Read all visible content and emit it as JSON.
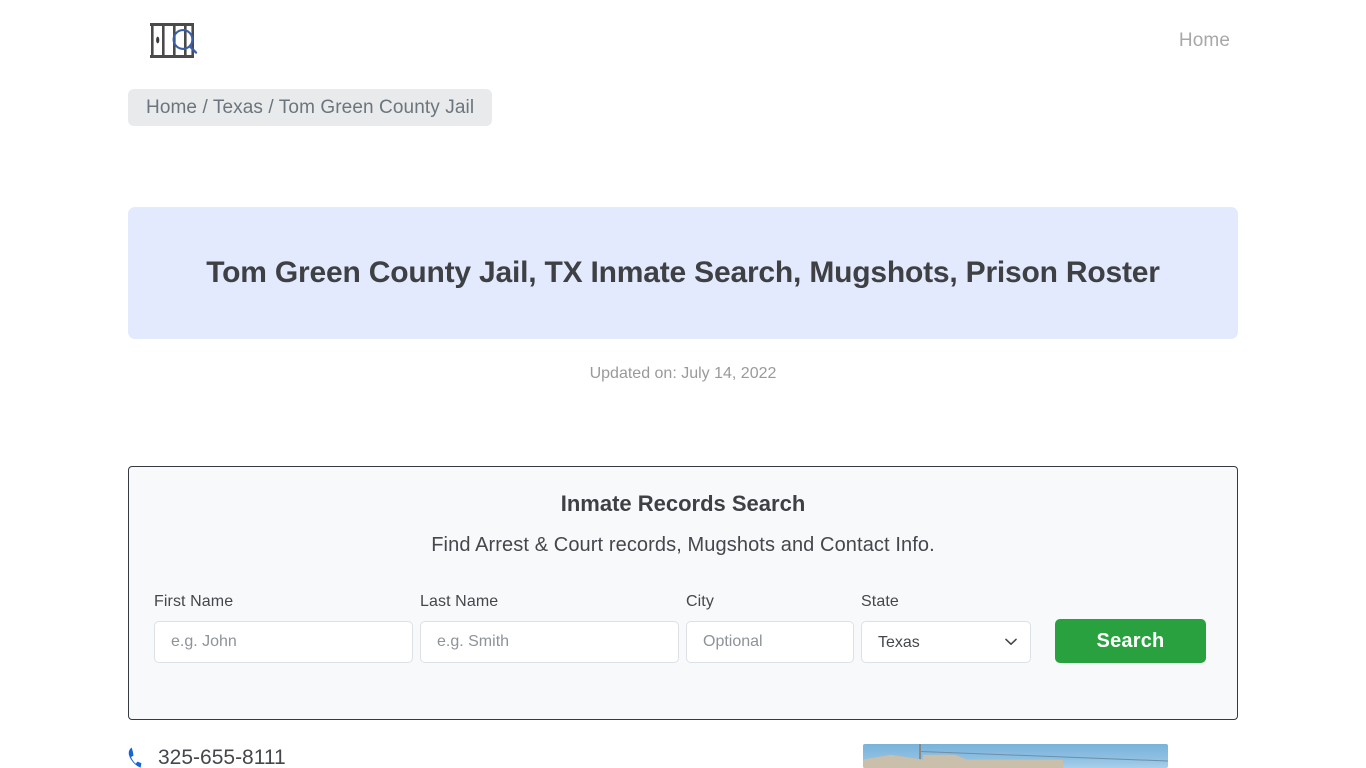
{
  "header": {
    "logo_name": "jail-bars-magnifier-logo",
    "logo_bar_color": "#4a4a4a",
    "logo_glass_color": "#3b5ea8",
    "nav": [
      {
        "label": "Home",
        "name": "nav-link-home"
      }
    ]
  },
  "breadcrumb": {
    "text": "Home / Texas / Tom Green County Jail",
    "items": [
      "Home",
      "Texas",
      "Tom Green County Jail"
    ],
    "separator": "/",
    "background": "#e9eaeb"
  },
  "banner": {
    "title": "Tom Green County Jail, TX Inmate Search, Mugshots, Prison Roster",
    "background": "#e3eafd",
    "text_color": "#3e4044"
  },
  "meta": {
    "updated_label": "Updated on: July 14, 2022"
  },
  "search": {
    "title": "Inmate Records Search",
    "subtitle": "Find Arrest & Court records, Mugshots and Contact Info.",
    "fields": {
      "first_name": {
        "label": "First Name",
        "placeholder": "e.g. John",
        "value": ""
      },
      "last_name": {
        "label": "Last Name",
        "placeholder": "e.g. Smith",
        "value": ""
      },
      "city": {
        "label": "City",
        "placeholder": "Optional",
        "value": ""
      },
      "state": {
        "label": "State",
        "selected": "Texas",
        "options": [
          "Texas"
        ]
      }
    },
    "submit_label": "Search",
    "submit_color": "#2aa13f",
    "panel_background": "#f8f9fa",
    "panel_border": "#343a40"
  },
  "contact": {
    "phone": "325-655-8111",
    "phone_icon": "phone-icon",
    "phone_icon_color": "#1565d8"
  },
  "photo": {
    "name": "facility-photo",
    "alt": "Tom Green County Jail building exterior"
  }
}
